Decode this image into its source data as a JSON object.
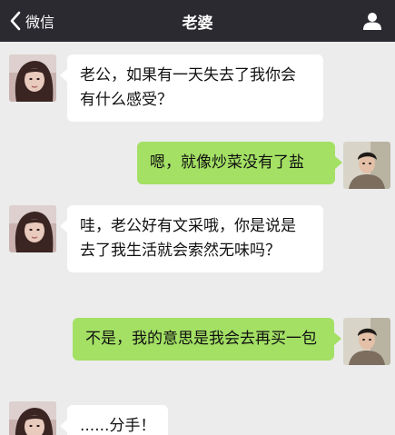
{
  "header": {
    "back_label": "微信",
    "title": "老婆",
    "back_icon": "chevron-left-icon",
    "profile_icon": "person-icon"
  },
  "colors": {
    "nav_bg": "#2b2a30",
    "chat_bg": "#ececec",
    "incoming_bubble": "#ffffff",
    "outgoing_bubble": "#a3e064"
  },
  "messages": [
    {
      "sender": "wife",
      "direction": "incoming",
      "text": "老公，如果有一天失去了我你会有什么感受？"
    },
    {
      "sender": "me",
      "direction": "outgoing",
      "text": "嗯，就像炒菜没有了盐"
    },
    {
      "sender": "wife",
      "direction": "incoming",
      "text": "哇，老公好有文采哦，你是说是去了我生活就会索然无味吗？"
    },
    {
      "sender": "me",
      "direction": "outgoing",
      "text": "不是，我的意思是我会去再买一包"
    },
    {
      "sender": "wife",
      "direction": "incoming",
      "text": "......分手！"
    }
  ]
}
